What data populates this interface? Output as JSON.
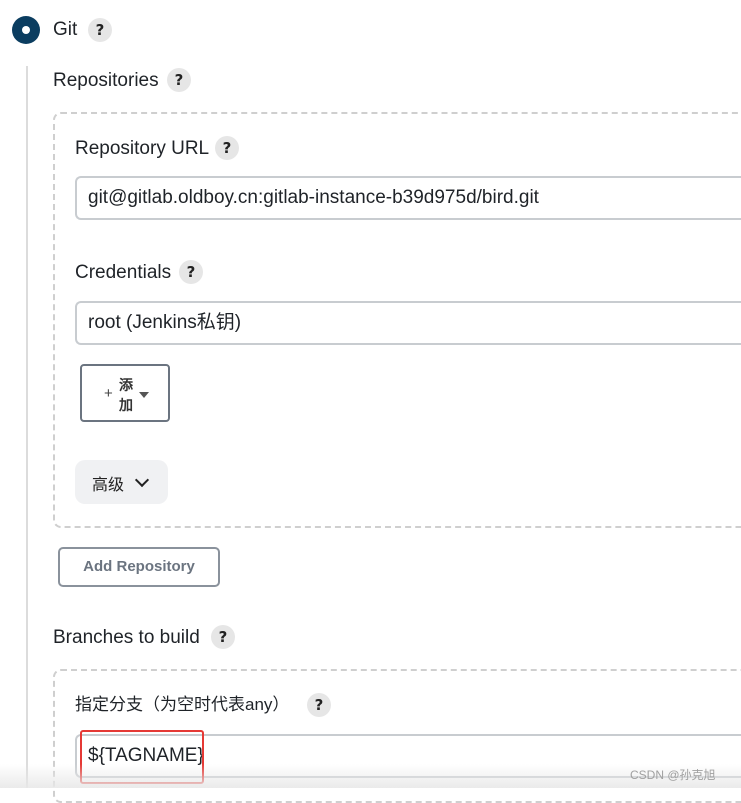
{
  "scm": {
    "label": "Git"
  },
  "repositories": {
    "label": "Repositories",
    "url_label": "Repository URL",
    "url_value": "git@gitlab.oldboy.cn:gitlab-instance-b39d975d/bird.git",
    "credentials_label": "Credentials",
    "credentials_value": "root (Jenkins私钥)",
    "add_plus": "+",
    "add_label_line1": "添",
    "add_label_line2": "加",
    "advanced_label": "高级",
    "add_repository_label": "Add Repository"
  },
  "branches": {
    "label": "Branches to build",
    "specifier_label": "指定分支（为空时代表any）",
    "specifier_value": "${TAGNAME}"
  },
  "help_glyph": "?",
  "watermark": "CSDN @孙克旭"
}
